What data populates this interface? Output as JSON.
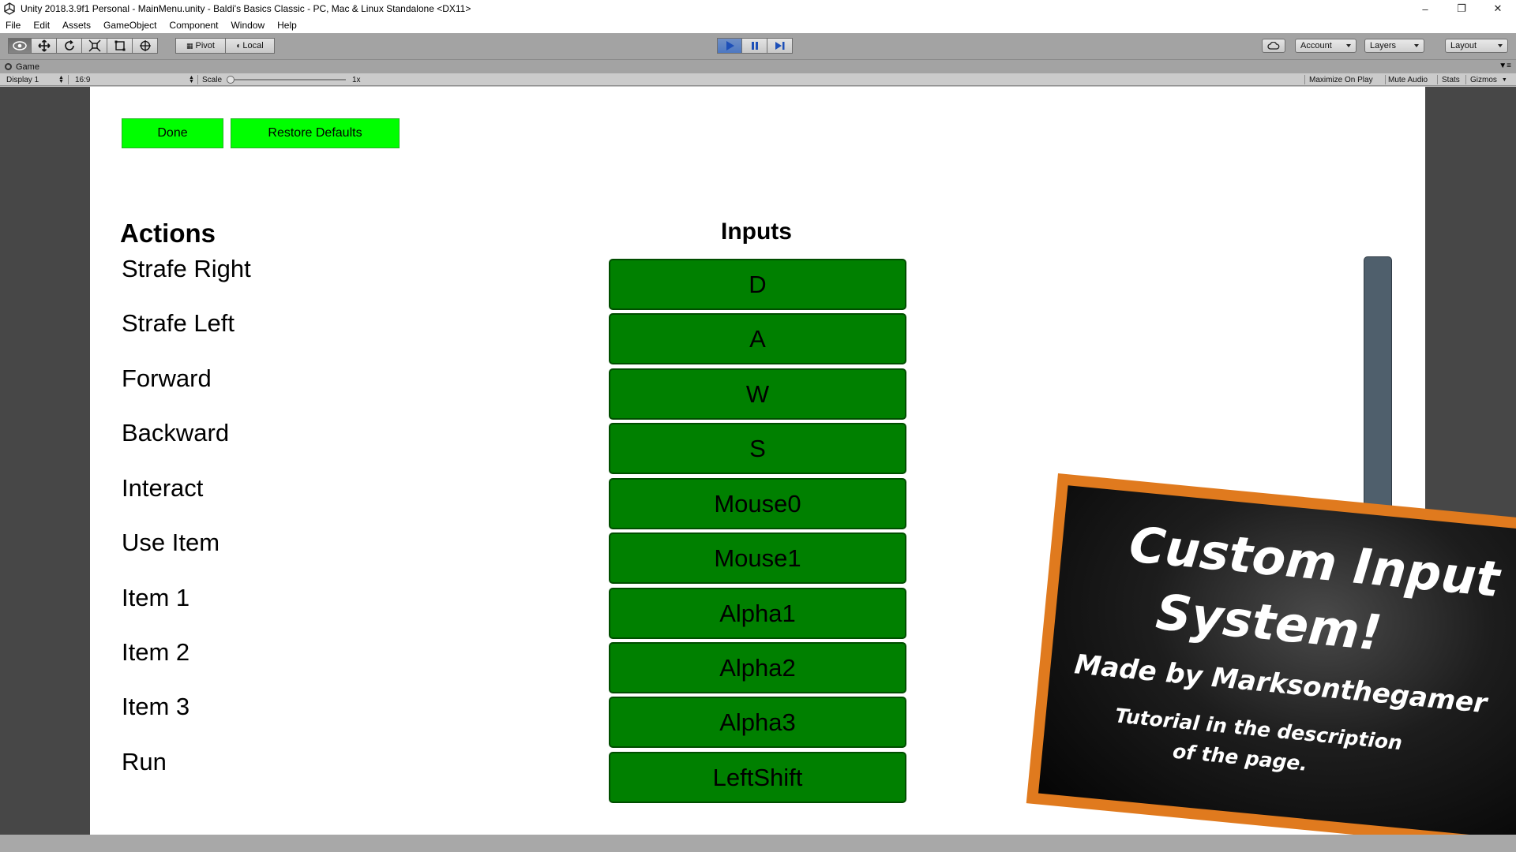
{
  "window": {
    "title": "Unity 2018.3.9f1 Personal - MainMenu.unity - Baldi's Basics Classic - PC, Mac & Linux Standalone <DX11>",
    "minimize": "–",
    "restore": "❐",
    "close": "✕"
  },
  "menu": {
    "items": [
      "File",
      "Edit",
      "Assets",
      "GameObject",
      "Component",
      "Window",
      "Help"
    ]
  },
  "toolbar": {
    "pivot_label": "Pivot",
    "local_label": "Local",
    "account_label": "Account",
    "layers_label": "Layers",
    "layout_label": "Layout"
  },
  "game_tab": {
    "label": "Game",
    "display": "Display 1",
    "aspect": "16:9",
    "scale_label": "Scale",
    "scale_value": "1x",
    "maximize_on_play": "Maximize On Play",
    "mute_audio": "Mute Audio",
    "stats": "Stats",
    "gizmos": "Gizmos"
  },
  "game": {
    "done_label": "Done",
    "restore_label": "Restore Defaults",
    "actions_heading": "Actions",
    "inputs_heading": "Inputs",
    "bindings": [
      {
        "action": "Strafe Right",
        "input": "D"
      },
      {
        "action": "Strafe Left",
        "input": "A"
      },
      {
        "action": "Forward",
        "input": "W"
      },
      {
        "action": "Backward",
        "input": "S"
      },
      {
        "action": "Interact",
        "input": "Mouse0"
      },
      {
        "action": "Use Item",
        "input": "Mouse1"
      },
      {
        "action": "Item 1",
        "input": "Alpha1"
      },
      {
        "action": "Item 2",
        "input": "Alpha2"
      },
      {
        "action": "Item 3",
        "input": "Alpha3"
      },
      {
        "action": "Run",
        "input": "LeftShift"
      }
    ]
  },
  "chalkboard": {
    "line1": "Custom Input",
    "line2": "System!",
    "line3": "Made by Marksonthegamer",
    "line4": "Tutorial in the description",
    "line5": "of the page."
  },
  "colors": {
    "bright_green": "#00ff00",
    "input_green": "#008000",
    "chalk_frame": "#e07a1e"
  }
}
